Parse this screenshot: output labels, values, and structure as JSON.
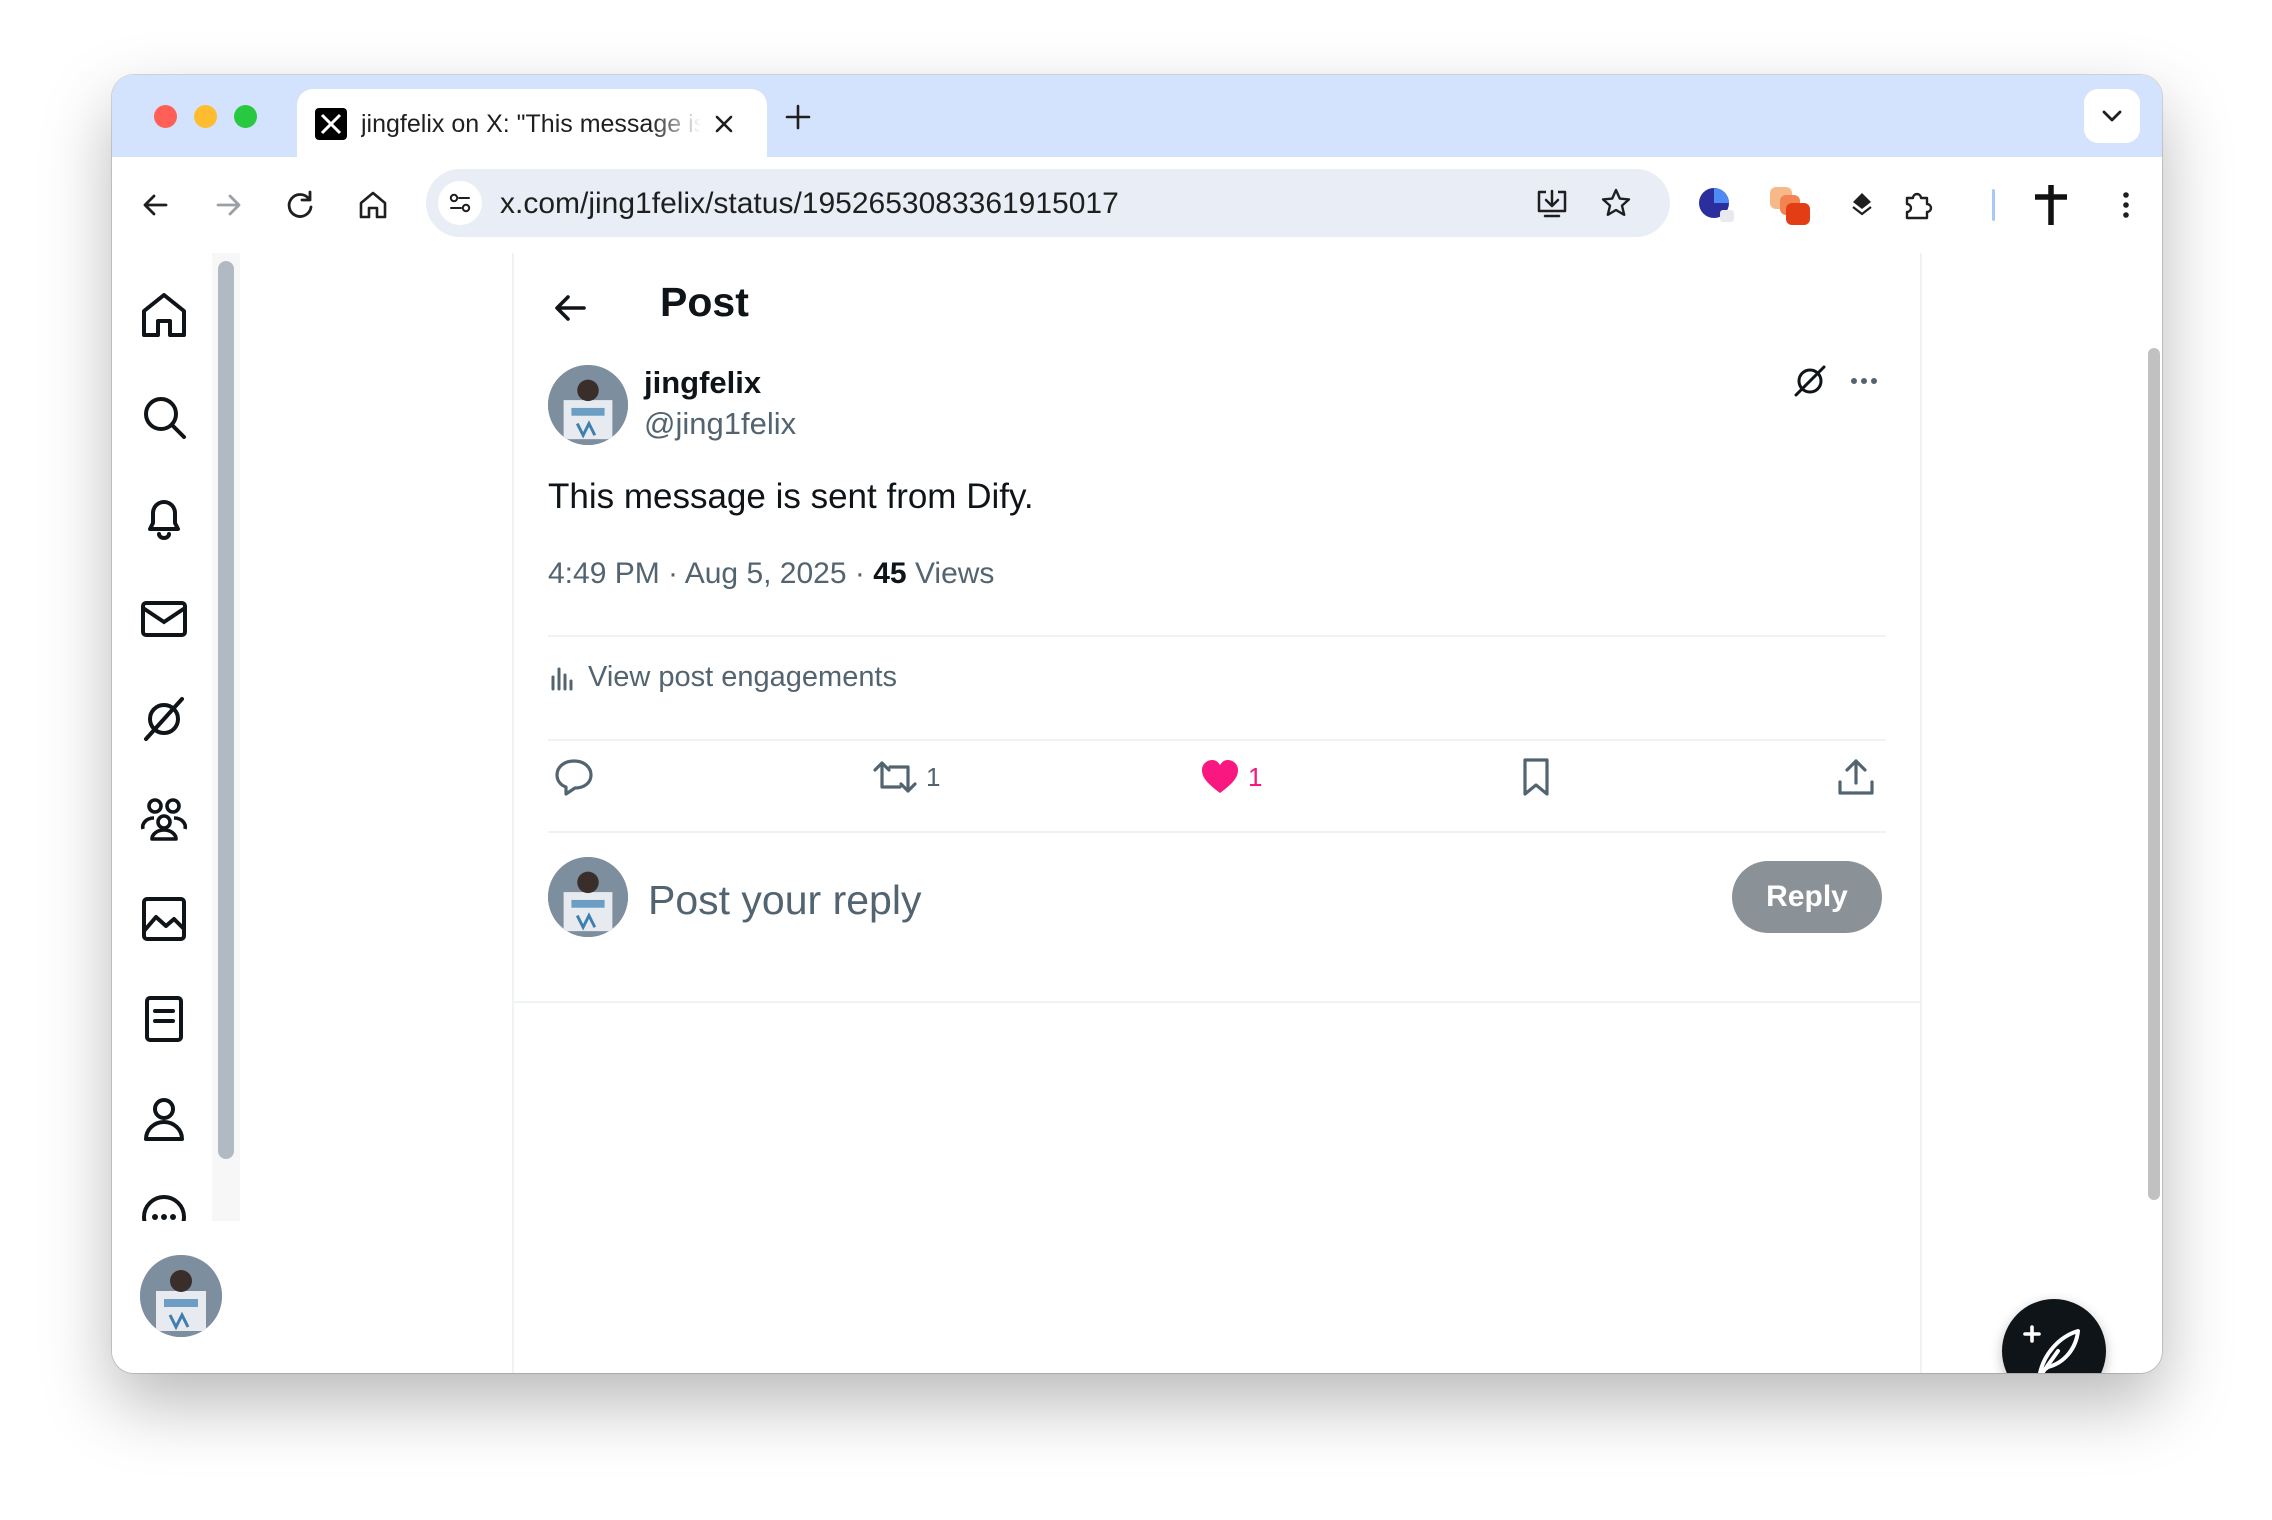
{
  "browser": {
    "tab_title": "jingfelix on X: \"This message is sent from Dify.\"",
    "url": "x.com/jing1felix/status/1952653083361915017"
  },
  "post_header": {
    "title": "Post"
  },
  "post": {
    "author_name": "jingfelix",
    "author_handle": "@jing1felix",
    "text": "This message is sent from Dify.",
    "timestamp": "4:49 PM · Aug 5, 2025",
    "separator": "·",
    "views_count": "45",
    "views_label": "Views",
    "engagements_label": "View post engagements",
    "reposts": "1",
    "likes": "1"
  },
  "reply_box": {
    "placeholder": "Post your reply",
    "button_label": "Reply"
  },
  "colors": {
    "accent": "#0f1419",
    "like": "#f91880",
    "tab_strip": "#d3e3fd",
    "muted": "#536471"
  },
  "icons": {
    "sidebar": [
      "home-icon",
      "search-icon",
      "bell-icon",
      "mail-icon",
      "grok-icon",
      "communities-icon",
      "media-icon",
      "lists-icon",
      "profile-icon",
      "more-icon"
    ]
  }
}
